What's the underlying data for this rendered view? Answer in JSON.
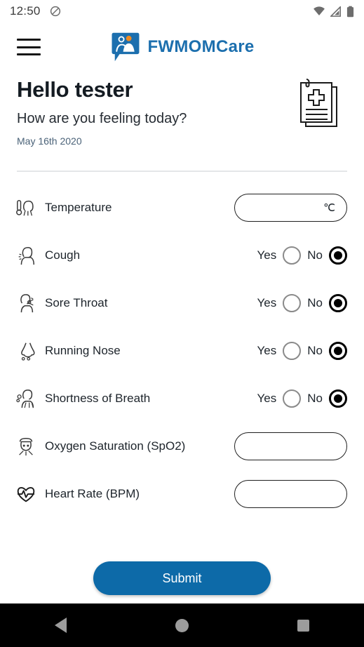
{
  "status_bar": {
    "time": "12:50",
    "icons": [
      "do-not-disturb-icon",
      "wifi-icon",
      "cellular-signal-icon",
      "battery-icon"
    ]
  },
  "app_bar": {
    "menu_icon": "hamburger-menu-icon",
    "logo_icon": "fwmomcare-logo-icon",
    "brand_name": "FWMOMCare",
    "brand_color": "#1c6fae"
  },
  "greeting": {
    "title": "Hello tester",
    "subtitle": "How are you feeling today?",
    "date": "May 16th 2020",
    "illustration": "medical-report-icon"
  },
  "form": {
    "rows": [
      {
        "id": "temperature",
        "label": "Temperature",
        "icon": "thermometer-head-icon",
        "control": "text-input",
        "value": "",
        "unit": "℃"
      },
      {
        "id": "cough",
        "label": "Cough",
        "icon": "cough-person-icon",
        "control": "radio",
        "yes_label": "Yes",
        "no_label": "No",
        "selected": "No"
      },
      {
        "id": "sore-throat",
        "label": "Sore Throat",
        "icon": "sore-throat-person-icon",
        "control": "radio",
        "yes_label": "Yes",
        "no_label": "No",
        "selected": "No"
      },
      {
        "id": "running-nose",
        "label": "Running Nose",
        "icon": "nose-icon",
        "control": "radio",
        "yes_label": "Yes",
        "no_label": "No",
        "selected": "No"
      },
      {
        "id": "shortness-of-breath",
        "label": "Shortness of Breath",
        "icon": "breathing-person-icon",
        "control": "radio",
        "yes_label": "Yes",
        "no_label": "No",
        "selected": "No"
      },
      {
        "id": "oxygen-saturation",
        "label": "Oxygen Saturation (SpO2)",
        "icon": "oxygen-mask-icon",
        "control": "text-input",
        "value": "",
        "unit": ""
      },
      {
        "id": "heart-rate",
        "label": "Heart Rate (BPM)",
        "icon": "heart-pulse-icon",
        "control": "text-input",
        "value": "",
        "unit": ""
      }
    ]
  },
  "submit": {
    "label": "Submit",
    "color": "#0d6aa8"
  },
  "nav_bar": {
    "back": "back-triangle-icon",
    "home": "home-circle-icon",
    "recent": "recent-apps-square-icon"
  }
}
